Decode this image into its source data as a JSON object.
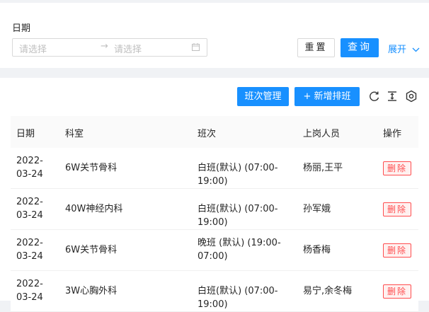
{
  "filter": {
    "date_label": "日期",
    "start_placeholder": "请选择",
    "separator": "→",
    "end_placeholder": "请选择",
    "reset_label": "重置",
    "query_label": "查询",
    "expand_label": "展开"
  },
  "toolbar": {
    "shift_manage_label": "班次管理",
    "new_schedule_label": "+ 新增排班"
  },
  "table": {
    "columns": [
      "日期",
      "科室",
      "班次",
      "上岗人员",
      "操作"
    ],
    "rows": [
      {
        "date": "2022-03-24",
        "dept": "6W关节骨科",
        "shift": "白班(默认) (07:00-19:00)",
        "staff": "杨丽,王平",
        "action": "删除"
      },
      {
        "date": "2022-03-24",
        "dept": "40W神经内科",
        "shift": "白班(默认) (07:00-19:00)",
        "staff": "孙军娥",
        "action": "删除"
      },
      {
        "date": "2022-03-24",
        "dept": "6W关节骨科",
        "shift": "晚班 (默认) (19:00-07:00)",
        "staff": "杨香梅",
        "action": "删除"
      },
      {
        "date": "2022-03-24",
        "dept": "3W心胸外科",
        "shift": "白班(默认) (07:00-19:00)",
        "staff": "易宁,余冬梅",
        "action": "删除"
      }
    ]
  },
  "colors": {
    "primary": "#1890ff",
    "danger": "#ff4d4f",
    "background": "#f0f2f5"
  }
}
